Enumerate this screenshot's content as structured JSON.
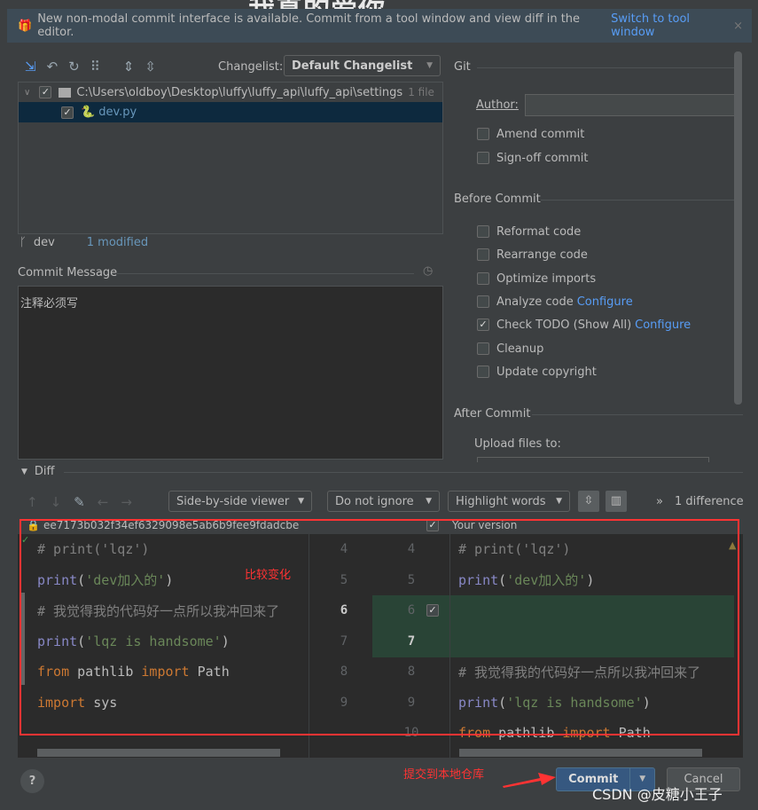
{
  "overlay_text": "我真的爱你",
  "banner": {
    "icon": "gift-icon",
    "text": "New non-modal commit interface is available. Commit from a tool window and view diff in the editor.",
    "link": "Switch to tool window",
    "close": "×"
  },
  "toolbar": {
    "changelist_label": "Changelist:",
    "changelist_value": "Default Changelist"
  },
  "tree": {
    "folder_path": "C:\\Users\\oldboy\\Desktop\\luffy\\luffy_api\\luffy_api\\settings",
    "folder_count": "1 file",
    "file": "dev.py"
  },
  "status": {
    "branch": "dev",
    "modified": "1 modified"
  },
  "commit_message": {
    "label": "Commit Message",
    "value": "注释必须写"
  },
  "git": {
    "title": "Git",
    "author_label": "Author:",
    "author_value": "",
    "amend": "Amend commit",
    "signoff": "Sign-off commit"
  },
  "before_commit": {
    "title": "Before Commit",
    "items": [
      {
        "label": "Reformat code",
        "checked": false,
        "link": ""
      },
      {
        "label": "Rearrange code",
        "checked": false,
        "link": ""
      },
      {
        "label": "Optimize imports",
        "checked": false,
        "link": ""
      },
      {
        "label": "Analyze code",
        "checked": false,
        "link": "Configure"
      },
      {
        "label": "Check TODO (Show All)",
        "checked": true,
        "link": "Configure"
      },
      {
        "label": "Cleanup",
        "checked": false,
        "link": ""
      },
      {
        "label": "Update copyright",
        "checked": false,
        "link": ""
      }
    ]
  },
  "after_commit": {
    "title": "After Commit",
    "upload_label": "Upload files to:"
  },
  "diff": {
    "title": "Diff",
    "viewer": "Side-by-side viewer",
    "ignore": "Do not ignore",
    "highlight": "Highlight words",
    "differences": "1 difference",
    "left_header": "ee7173b032f34ef6329098e5ab6b9fee9fdadcbe",
    "right_header": "Your version",
    "left_lines": [
      "# print('lqz')",
      "print('dev加入的')",
      "# 我觉得我的代码好一点所以我冲回来了",
      "print('lqz is handsome')",
      "from pathlib import Path",
      "import sys"
    ],
    "left_nums": [
      "4",
      "5",
      "6",
      "7",
      "8",
      "9"
    ],
    "right_nums": [
      "4",
      "5",
      "6",
      "7",
      "8",
      "9",
      "10"
    ],
    "right_lines": [
      "# print('lqz')",
      "print('dev加入的')",
      "",
      "",
      "# 我觉得我的代码好一点所以我冲回来了",
      "print('lqz is handsome')",
      "from pathlib import Path"
    ]
  },
  "annotations": {
    "compare": "比较变化",
    "commit_hint": "提交到本地仓库"
  },
  "buttons": {
    "help": "?",
    "commit": "Commit",
    "cancel": "Cancel"
  },
  "watermark": "CSDN @皮糖小王子",
  "colors": {
    "accent": "#589df6",
    "annotation": "#ff3333",
    "diff_added": "#294436",
    "commit_button": "#365880"
  }
}
